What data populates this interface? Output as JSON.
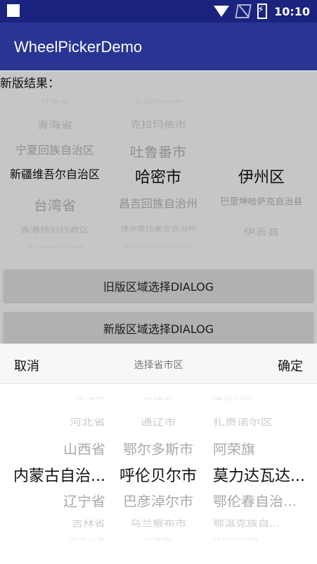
{
  "status": {
    "time": "10:10"
  },
  "appbar": {
    "title": "WheelPickerDemo"
  },
  "result_label": "新版结果：",
  "old_picker": {
    "provinces": [
      "甘肃省",
      "青海省",
      "宁夏回族自治区",
      "新疆维吾尔自治区",
      "台湾省",
      "香港特别行政区",
      "澳门特别行政区"
    ],
    "cities": [
      "克拉玛依市",
      "克拉玛依市",
      "吐鲁番市",
      "哈密市",
      "昌吉回族自治州",
      "博尔塔拉蒙古自治州",
      "巴音郭楞蒙古自治州"
    ],
    "districts": [
      "",
      "",
      "",
      "伊州区",
      "巴里坤哈萨克自治县",
      "伊吾县",
      ""
    ]
  },
  "buttons": {
    "old_dialog": "旧版区域选择DIALOG",
    "new_dialog": "新版区域选择DIALOG"
  },
  "sheet": {
    "cancel": "取消",
    "title": "选择省市区",
    "confirm": "确定"
  },
  "new_picker": {
    "provinces": [
      "天津市",
      "河北省",
      "山西省",
      "内蒙古自治...",
      "辽宁省",
      "吉林省",
      "黑龙江省"
    ],
    "cities": [
      "赤峰市",
      "通辽市",
      "鄂尔多斯市",
      "呼伦贝尔市",
      "巴彦淖尔市",
      "乌兰察布市",
      "兴安盟"
    ],
    "districts": [
      "海拉尔区",
      "扎赉诺尔区",
      "阿荣旗",
      "莫力达瓦达...",
      "鄂伦春自治...",
      "鄂温克族自...",
      "陈巴尔虎旗"
    ]
  }
}
